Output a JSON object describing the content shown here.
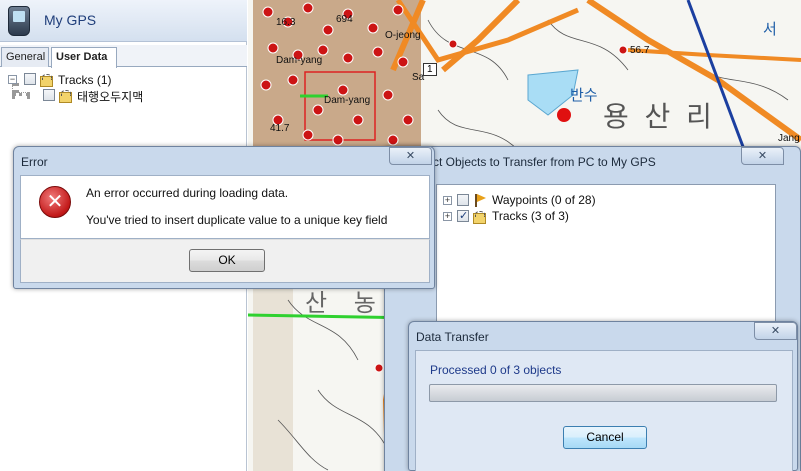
{
  "app": {
    "title": "My GPS",
    "tabs": [
      "General",
      "User Data"
    ],
    "active_tab": "User Data"
  },
  "tree": {
    "root_label": "Tracks (1)",
    "child_label": "태행오두지맥"
  },
  "map": {
    "labels": [
      "16.3",
      "694",
      "O-jeong",
      "Dam-yang",
      "Dam-yang",
      "Sa",
      "41.7",
      "56.7",
      "1",
      "Jang",
      "Sa",
      "반수",
      "용 산 리 ",
      "서",
      "산 농"
    ]
  },
  "error_dialog": {
    "title": "Error",
    "line1": "An error occurred during loading data.",
    "line2": "You've tried to insert duplicate value to a unique key field",
    "ok_label": "OK",
    "close_label": "✕"
  },
  "select_window": {
    "title": "ct Objects to Transfer from PC to My GPS",
    "close_label": "✕",
    "items": [
      {
        "label": "Waypoints (0 of 28)",
        "checked": false
      },
      {
        "label": "Tracks (3 of 3)",
        "checked": true
      }
    ]
  },
  "transfer_dialog": {
    "title": "Data Transfer",
    "status": "Processed 0 of 3 objects",
    "progress": 0,
    "cancel_label": "Cancel",
    "close_label": "✕"
  },
  "colors": {
    "error_red": "#c21818",
    "link_blue": "#1e3a8a",
    "road_orange": "#f08a24",
    "road_green": "#2fd12f",
    "road_blue": "#1b3fa0",
    "water_blue": "#a9ddf5"
  }
}
